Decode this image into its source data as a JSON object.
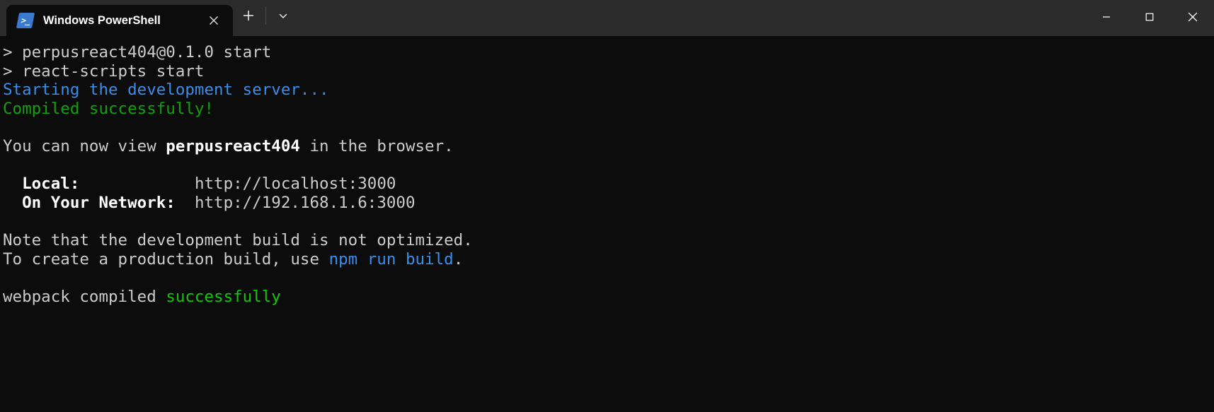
{
  "window": {
    "title": "Windows PowerShell",
    "app_icon": "powershell-icon",
    "icon_glyph": ">_"
  },
  "tabbar": {
    "tab_label": "Windows PowerShell",
    "close_icon": "close-icon",
    "new_tab_icon": "plus-icon",
    "dropdown_icon": "chevron-down-icon"
  },
  "window_controls": {
    "minimize": "minimize-icon",
    "maximize": "maximize-icon",
    "close": "close-icon"
  },
  "colors": {
    "background": "#0c0c0c",
    "titlebar": "#2b2b2b",
    "text": "#cccccc",
    "bright_text": "#ffffff",
    "blue": "#3b8eea",
    "green": "#16c60c",
    "accent_icon": "#3b78cf"
  },
  "terminal": {
    "lines": [
      {
        "id": "line-npm-package",
        "segments": [
          {
            "text": "> perpusreact404@0.1.0 start",
            "style": "c-white"
          }
        ]
      },
      {
        "id": "line-npm-command",
        "segments": [
          {
            "text": "> react-scripts start",
            "style": "c-white"
          }
        ]
      },
      {
        "id": "line-starting-server",
        "segments": [
          {
            "text": "Starting the development server...",
            "style": "c-blue"
          }
        ]
      },
      {
        "id": "line-compiled-successfully",
        "segments": [
          {
            "text": "Compiled successfully!",
            "style": "c-darkgreen"
          }
        ]
      },
      {
        "id": "line-blank-1",
        "segments": [
          {
            "text": " ",
            "style": "c-white"
          }
        ]
      },
      {
        "id": "line-view-in-browser",
        "segments": [
          {
            "text": "You can now view ",
            "style": "c-white"
          },
          {
            "text": "perpusreact404",
            "style": "c-bright"
          },
          {
            "text": " in the browser.",
            "style": "c-white"
          }
        ]
      },
      {
        "id": "line-blank-2",
        "segments": [
          {
            "text": " ",
            "style": "c-white"
          }
        ]
      },
      {
        "id": "line-local-url",
        "segments": [
          {
            "text": "  Local:            ",
            "style": "c-bright"
          },
          {
            "text": "http://localhost:3000",
            "style": "c-white"
          }
        ]
      },
      {
        "id": "line-network-url",
        "segments": [
          {
            "text": "  On Your Network:  ",
            "style": "c-bright"
          },
          {
            "text": "http://192.168.1.6:3000",
            "style": "c-white"
          }
        ]
      },
      {
        "id": "line-blank-3",
        "segments": [
          {
            "text": " ",
            "style": "c-white"
          }
        ]
      },
      {
        "id": "line-note-dev-build",
        "segments": [
          {
            "text": "Note that the development build is not optimized.",
            "style": "c-white"
          }
        ]
      },
      {
        "id": "line-production-build",
        "segments": [
          {
            "text": "To create a production build, use ",
            "style": "c-white"
          },
          {
            "text": "npm run build",
            "style": "c-blue"
          },
          {
            "text": ".",
            "style": "c-white"
          }
        ]
      },
      {
        "id": "line-blank-4",
        "segments": [
          {
            "text": " ",
            "style": "c-white"
          }
        ]
      },
      {
        "id": "line-webpack-compiled",
        "segments": [
          {
            "text": "webpack compiled ",
            "style": "c-white"
          },
          {
            "text": "successfully",
            "style": "c-green"
          }
        ]
      }
    ]
  }
}
